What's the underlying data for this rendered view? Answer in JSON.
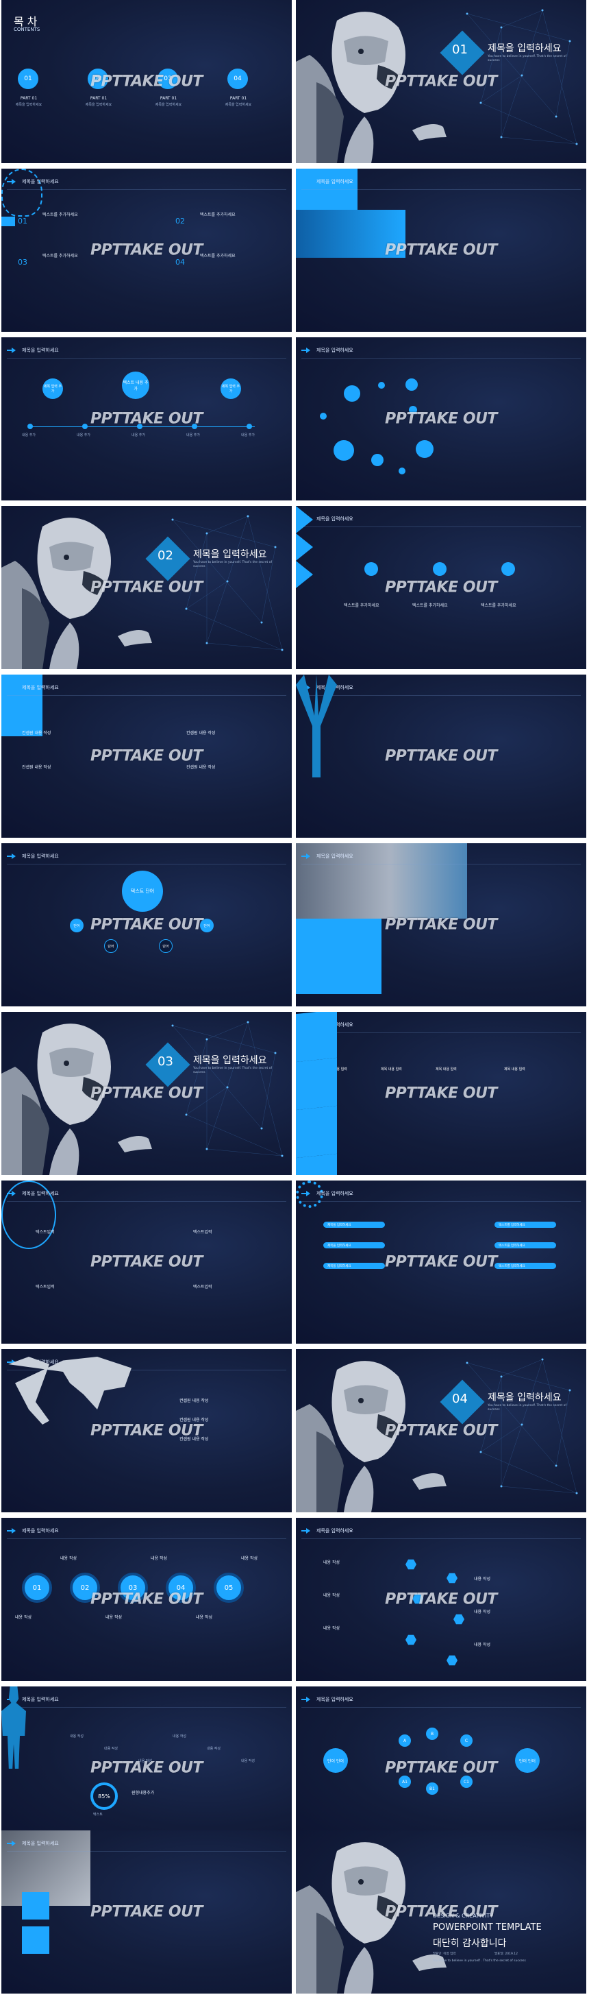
{
  "watermark": "PPTTAKE OUT",
  "header_title": "제목을 입력하세요",
  "colors": {
    "accent": "#1ea7ff",
    "bg_dark": "#121c3a",
    "bg_deep": "#0c1330"
  },
  "s1": {
    "title": "목 차",
    "subtitle": "CONTENTS",
    "items": [
      {
        "num": "01",
        "part": "PART 01",
        "desc": "제목을 입력하세요"
      },
      {
        "num": "02",
        "part": "PART 01",
        "desc": "제목을 입력하세요"
      },
      {
        "num": "03",
        "part": "PART 01",
        "desc": "제목을 입력하세요"
      },
      {
        "num": "04",
        "part": "PART 01",
        "desc": "제목을 입력하세요"
      }
    ]
  },
  "section_title": "제목을 입력하세요",
  "section_nums": [
    "01",
    "02",
    "03",
    "04"
  ],
  "section_sub": "You have to believe in yourself. That's the secret of success",
  "s3": {
    "labels": [
      "텍스트를 추가하세요",
      "텍스트를 추가하세요",
      "텍스트를 추가하세요",
      "텍스트를 추가하세요"
    ],
    "nums": [
      "01",
      "02",
      "03",
      "04"
    ]
  },
  "s5": {
    "top": "텍스트 내용 추가",
    "left": "제목 입력 추가",
    "right": "제목 입력 추가",
    "bottom_labels": [
      "내용 추가",
      "내용 추가",
      "내용 추가",
      "내용 추가",
      "내용 추가"
    ]
  },
  "s8": {
    "labels": [
      "텍스트를 추가하세요",
      "텍스트를 추가하세요",
      "텍스트를 추가하세요"
    ]
  },
  "s9": {
    "labels": [
      "컨셉원 내용 작성",
      "컨셉원 내용 작성",
      "컨셉원 내용 작성",
      "컨셉원 내용 작성"
    ]
  },
  "s11": {
    "center": "텍스트 단어",
    "l": "단어",
    "m": "단어",
    "r": "단어",
    "n": "단어"
  },
  "s14": {
    "labels": [
      "제목 내용 입력",
      "제목 내용 입력",
      "제목 내용 입력",
      "제목 내용 입력"
    ]
  },
  "s15": {
    "labels": [
      "텍스트입력",
      "텍스트입력",
      "텍스트입력",
      "텍스트입력"
    ]
  },
  "s16": {
    "left": [
      "제목을 입력하세요",
      "제목을 입력하세요",
      "제목을 입력하세요"
    ],
    "right": [
      "텍스트를 입력하세요",
      "텍스트를 입력하세요",
      "텍스트를 입력하세요"
    ]
  },
  "s17": {
    "labels": [
      "컨셉원 내용 작성",
      "컨셉원 내용 작성",
      "컨셉원 내용 작성"
    ]
  },
  "s19": {
    "nums": [
      "01",
      "02",
      "03",
      "04",
      "05"
    ],
    "labels": [
      "내용 작성",
      "내용 작성",
      "내용 작성",
      "내용 작성",
      "내용 작성",
      "내용 작성"
    ]
  },
  "s20": {
    "labels": [
      "내용 작성",
      "내용 작성",
      "내용 작성",
      "내용 작성",
      "내용 작성",
      "내용 작성"
    ]
  },
  "s21": {
    "pct": "85%",
    "pct_label": "텍스트",
    "side": "원형내용추가",
    "labels": [
      "내용 작성",
      "내용 작성",
      "내용 작성",
      "내용 작성",
      "내용 작성",
      "내용 작성"
    ]
  },
  "s22": {
    "left": "단어 단어",
    "right": "단어 단어",
    "nodes": [
      "A",
      "B",
      "C",
      "A1",
      "B1",
      "C1"
    ]
  },
  "s24": {
    "tag": "DESIGN & CREATIVITY",
    "title": "POWERPOINT TEMPLATE",
    "thanks": "대단히 감사합니다",
    "presenter_label": "발표인: 이름 입력",
    "date_label": "발표일: 2019.12",
    "quote": "You have to believe in yourself . That's the secret of success"
  }
}
